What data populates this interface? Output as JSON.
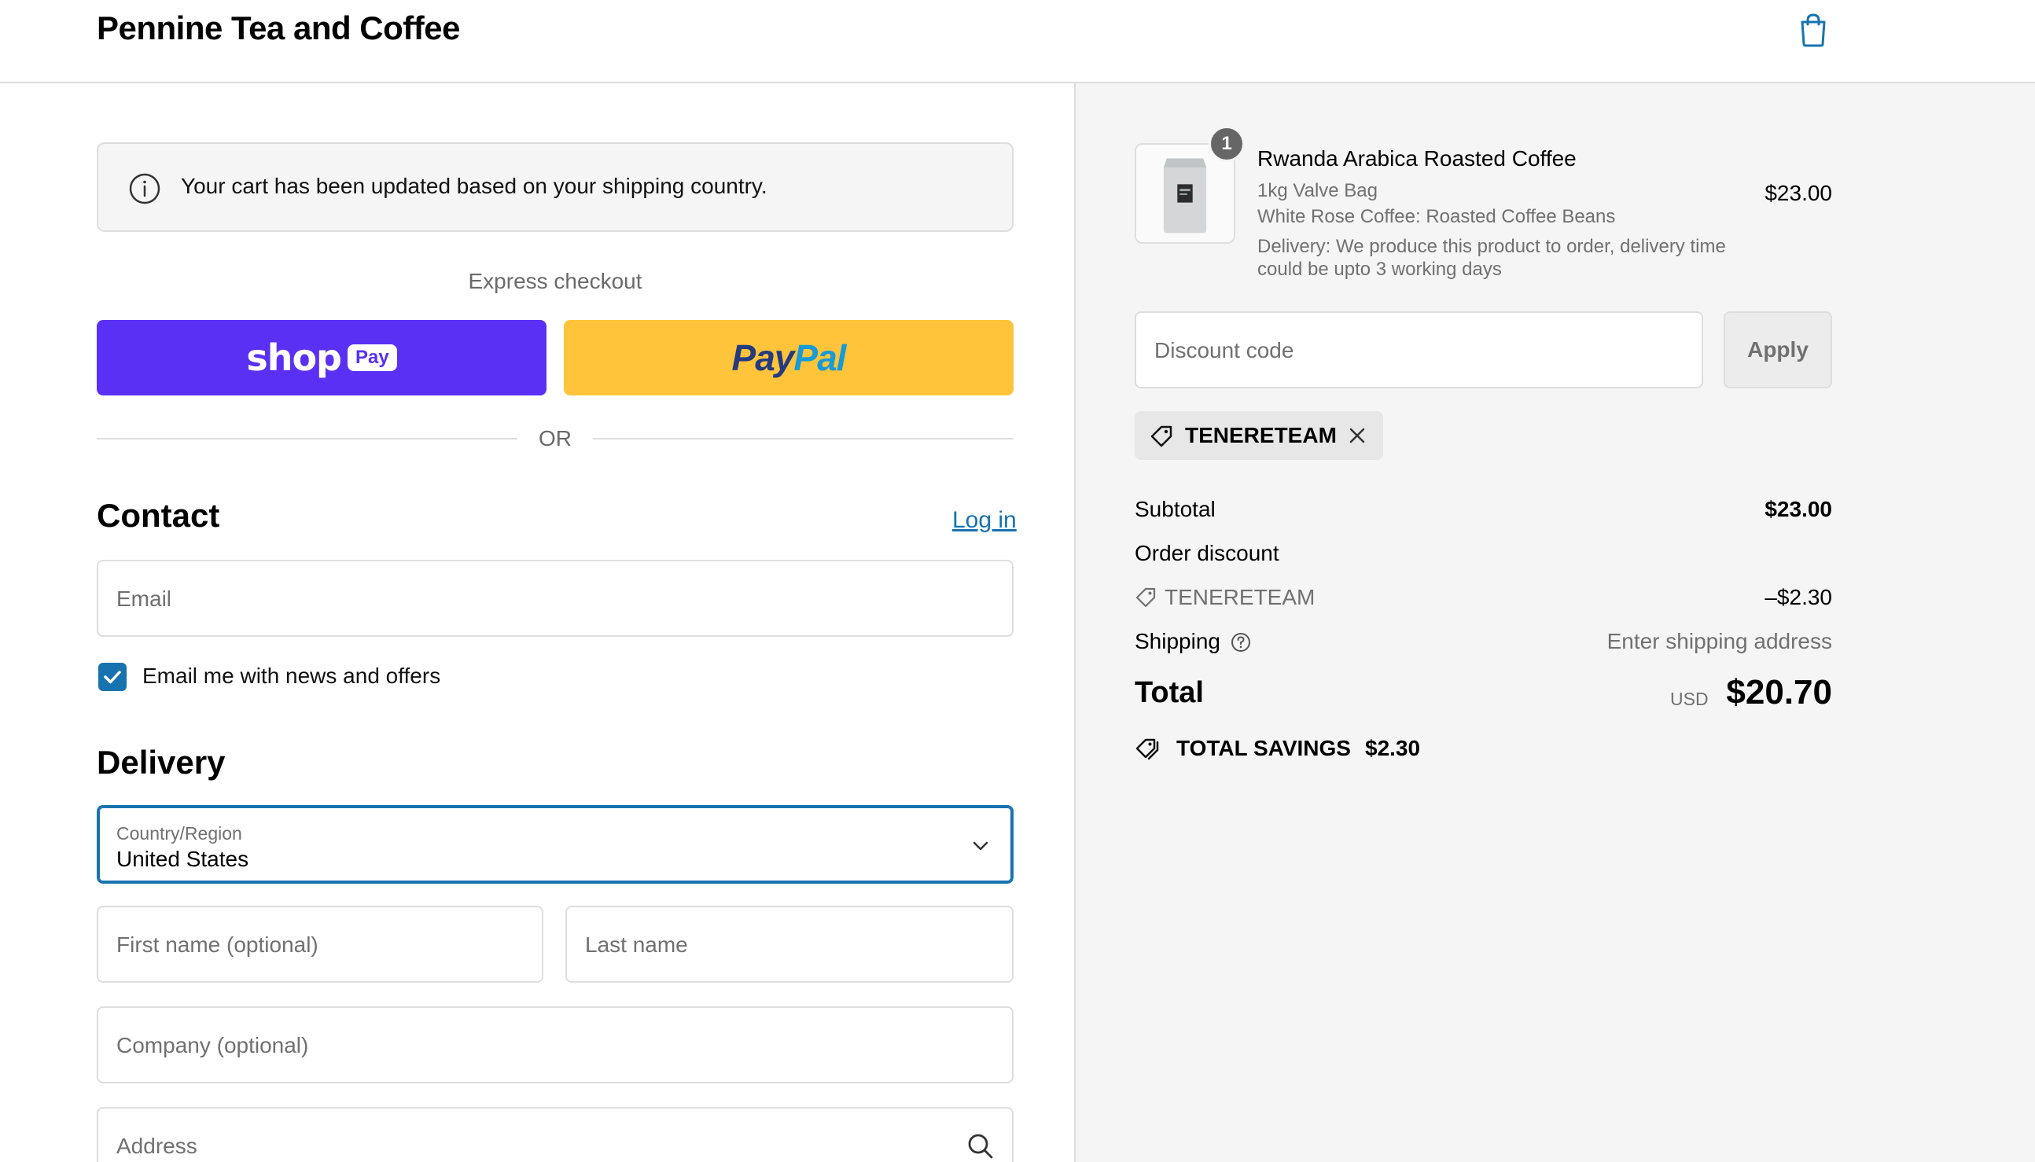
{
  "header": {
    "shop_name": "Pennine Tea and Coffee",
    "cart_icon": "shopping-bag-icon"
  },
  "notice": {
    "icon": "info-icon",
    "text": "Your cart has been updated based on your shipping country."
  },
  "express": {
    "label": "Express checkout",
    "shop_pay_word": "shop",
    "shop_pay_badge": "Pay",
    "paypal_a": "Pay",
    "paypal_b": "Pal",
    "or_text": "OR"
  },
  "contact": {
    "title": "Contact",
    "login_label": "Log in",
    "email_placeholder": "Email",
    "newsletter_checked": true,
    "newsletter_label": "Email me with news and offers"
  },
  "delivery": {
    "title": "Delivery",
    "country_label": "Country/Region",
    "country_value": "United States",
    "first_name_placeholder": "First name (optional)",
    "last_name_placeholder": "Last name",
    "company_placeholder": "Company (optional)",
    "address_placeholder": "Address"
  },
  "order": {
    "item": {
      "quantity": "1",
      "title": "Rwanda Arabica Roasted Coffee",
      "variant": "1kg Valve Bag",
      "vendor": "White Rose Coffee: Roasted Coffee Beans",
      "delivery_note": "Delivery: We produce this product to order, delivery time could be upto 3 working days",
      "price": "$23.00"
    },
    "discount_placeholder": "Discount code",
    "apply_label": "Apply",
    "applied_code": "TENERETEAM",
    "subtotal_label": "Subtotal",
    "subtotal_value": "$23.00",
    "order_discount_label": "Order discount",
    "discount_code_line": "TENERETEAM",
    "discount_value": "–$2.30",
    "shipping_label": "Shipping",
    "shipping_value": "Enter shipping address",
    "total_label": "Total",
    "currency": "USD",
    "total_value": "$20.70",
    "savings_label": "TOTAL SAVINGS",
    "savings_value": "$2.30"
  },
  "colors": {
    "accent": "#1773b0",
    "shop_pay": "#5a31f4",
    "paypal": "#ffc439"
  }
}
